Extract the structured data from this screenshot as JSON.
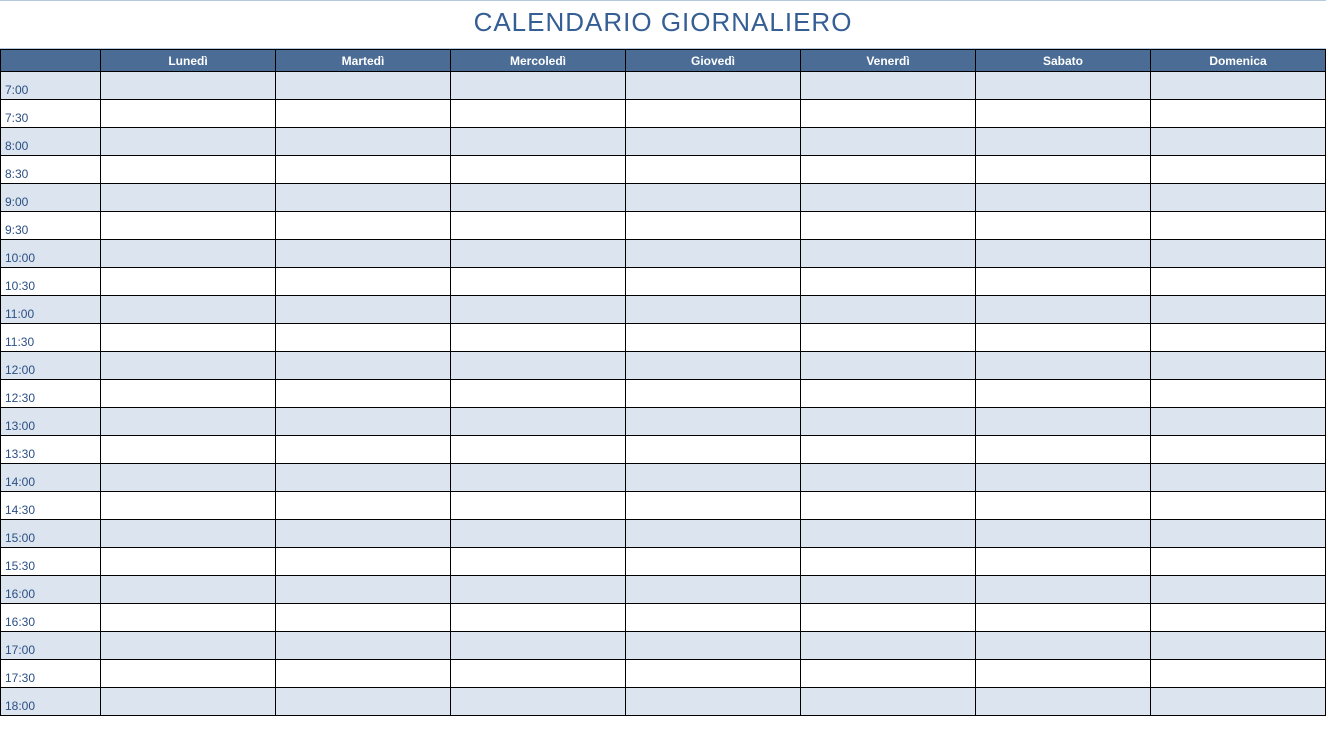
{
  "title": "CALENDARIO GIORNALIERO",
  "days": [
    "Lunedì",
    "Martedì",
    "Mercoledì",
    "Giovedì",
    "Venerdì",
    "Sabato",
    "Domenica"
  ],
  "times": [
    "7:00",
    "7:30",
    "8:00",
    "8:30",
    "9:00",
    "9:30",
    "10:00",
    "10:30",
    "11:00",
    "11:30",
    "12:00",
    "12:30",
    "13:00",
    "13:30",
    "14:00",
    "14:30",
    "15:00",
    "15:30",
    "16:00",
    "16:30",
    "17:00",
    "17:30",
    "18:00"
  ],
  "cells": {}
}
